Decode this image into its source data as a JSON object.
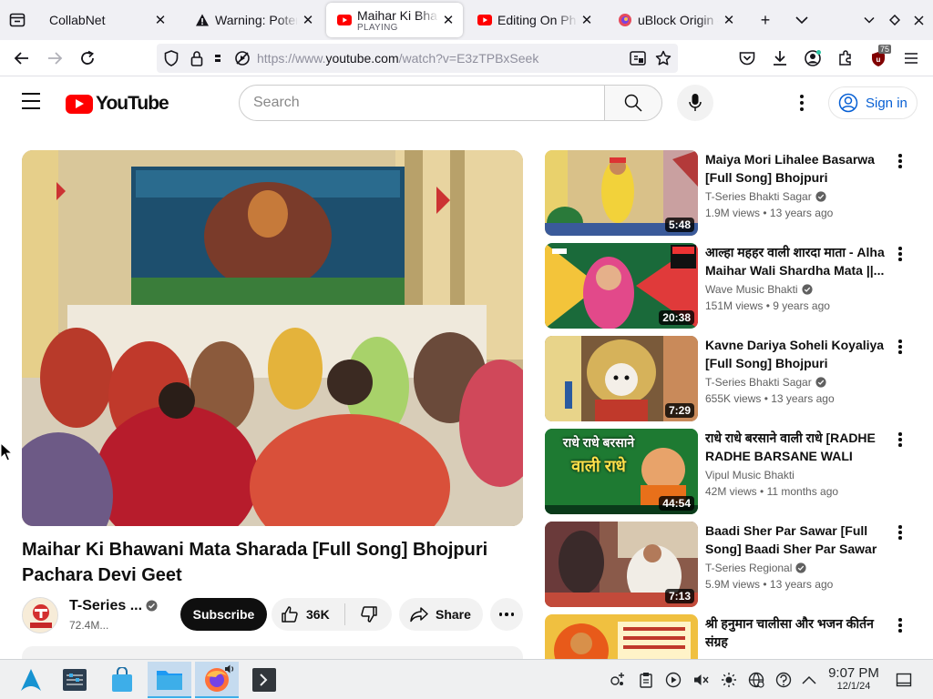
{
  "browser": {
    "tabs": [
      {
        "title": "CollabNet",
        "subtitle": "",
        "active": false
      },
      {
        "title": "Warning: Potential Security Risk Ahead",
        "subtitle": "",
        "active": false
      },
      {
        "title": "Maihar Ki Bhawani Mata Sharada",
        "subtitle": "PLAYING",
        "active": true
      },
      {
        "title": "Editing On Photo",
        "subtitle": "",
        "active": false
      },
      {
        "title": "uBlock Origin - an efficient blocker",
        "subtitle": "",
        "active": false
      }
    ],
    "close_glyph": "✕",
    "new_tab_glyph": "+",
    "url_prefix": "https://www.",
    "url_domain": "youtube.com",
    "url_path": "/watch?v=E3zTPBxSeek",
    "ublock_badge": "75"
  },
  "youtube": {
    "logo_text": "YouTube",
    "search_placeholder": "Search",
    "sign_in_label": "Sign in",
    "accent_color": "#ff0000"
  },
  "video": {
    "title": "Maihar Ki Bhawani Mata Sharada [Full Song] Bhojpuri Pachara Devi Geet",
    "channel": "T-Series ...",
    "subscribers": "72.4M...",
    "subscribe_label": "Subscribe",
    "likes": "36K",
    "share_label": "Share"
  },
  "related": [
    {
      "title": "Maiya Mori Lihalee Basarwa [Full Song] Bhojpuri Pachara...",
      "channel": "T-Series Bhakti Sagar",
      "verified": true,
      "views": "1.9M views",
      "age": "13 years ago",
      "duration": "5:48"
    },
    {
      "title": "आल्हा महहर वाली शारदा माता - Alha Maihar Wali Shardha Mata ||...",
      "channel": "Wave Music Bhakti",
      "verified": true,
      "views": "151M views",
      "age": "9 years ago",
      "duration": "20:38"
    },
    {
      "title": "Kavne Dariya Soheli Koyaliya [Full Song] Bhojpuri Pachara...",
      "channel": "T-Series Bhakti Sagar",
      "verified": true,
      "views": "655K views",
      "age": "13 years ago",
      "duration": "7:29"
    },
    {
      "title": "राधे राधे बरसाने वाली राधे [RADHE RADHE BARSANE WALI RADH...",
      "channel": "Vipul Music Bhakti",
      "verified": false,
      "views": "42M views",
      "age": "11 months ago",
      "duration": "44:54"
    },
    {
      "title": "Baadi Sher Par Sawar [Full Song] Baadi Sher Par Sawar",
      "channel": "T-Series Regional",
      "verified": true,
      "views": "5.9M views",
      "age": "13 years ago",
      "duration": "7:13"
    },
    {
      "title": "श्री हनुमान चालीसा और भजन कीर्तन संग्रह",
      "channel": "",
      "verified": false,
      "views": "",
      "age": "",
      "duration": ""
    }
  ],
  "thumb_texts": {
    "t4_line1": "राधे राधे बरसाने",
    "t4_line2": "वाली राधे"
  },
  "taskbar": {
    "time": "9:07 PM",
    "date": "12/1/24"
  }
}
